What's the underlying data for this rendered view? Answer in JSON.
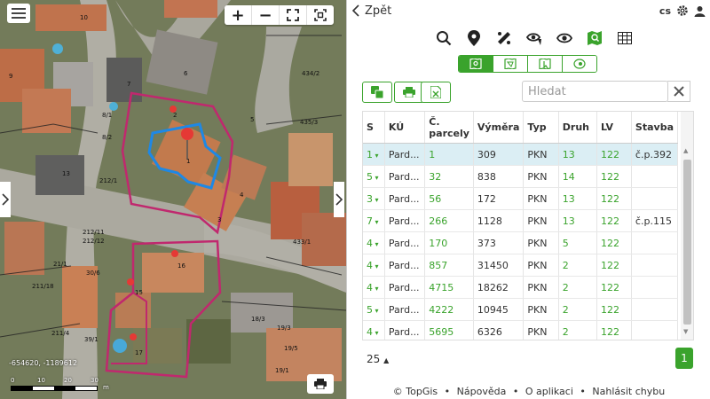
{
  "map": {
    "zoom_in": "+",
    "zoom_out": "−",
    "coords": "-654620, -1189612",
    "scale_labels": [
      "0",
      "10",
      "20",
      "30",
      "m"
    ],
    "parcel_labels": [
      "10",
      "9",
      "8",
      "7",
      "6",
      "5",
      "4",
      "3",
      "2",
      "1",
      "13",
      "14",
      "15",
      "16",
      "17",
      "18/3",
      "19/3",
      "19/5",
      "19/1",
      "8/2",
      "8/1",
      "212/1",
      "212/11",
      "212/12",
      "30/6",
      "39/1",
      "211/18",
      "211/4",
      "433/1",
      "434/2",
      "435/3",
      "26",
      "23/2",
      "21/1"
    ]
  },
  "panel": {
    "back_label": "Zpět",
    "lang": "cs",
    "search_placeholder": "Hledat",
    "page_size": "25",
    "current_page": "1",
    "footer": {
      "copyright": "© TopGis",
      "help": "Nápověda",
      "about": "O aplikaci",
      "report": "Nahlásit chybu",
      "sep": "•"
    }
  },
  "table": {
    "headers": [
      "S",
      "KÚ",
      "Č. parcely",
      "Výměra",
      "Typ",
      "Druh",
      "LV",
      "Stavba"
    ],
    "rows": [
      {
        "s": "1",
        "ku": "Pard...",
        "parcela": "1",
        "vymera": "309",
        "typ": "PKN",
        "druh": "13",
        "lv": "122",
        "stavba": "č.p.392"
      },
      {
        "s": "5",
        "ku": "Pard...",
        "parcela": "32",
        "vymera": "838",
        "typ": "PKN",
        "druh": "14",
        "lv": "122",
        "stavba": ""
      },
      {
        "s": "3",
        "ku": "Pard...",
        "parcela": "56",
        "vymera": "172",
        "typ": "PKN",
        "druh": "13",
        "lv": "122",
        "stavba": ""
      },
      {
        "s": "7",
        "ku": "Pard...",
        "parcela": "266",
        "vymera": "1128",
        "typ": "PKN",
        "druh": "13",
        "lv": "122",
        "stavba": "č.p.115"
      },
      {
        "s": "4",
        "ku": "Pard...",
        "parcela": "170",
        "vymera": "373",
        "typ": "PKN",
        "druh": "5",
        "lv": "122",
        "stavba": ""
      },
      {
        "s": "4",
        "ku": "Pard...",
        "parcela": "857",
        "vymera": "31450",
        "typ": "PKN",
        "druh": "2",
        "lv": "122",
        "stavba": ""
      },
      {
        "s": "4",
        "ku": "Pard...",
        "parcela": "4715",
        "vymera": "18262",
        "typ": "PKN",
        "druh": "2",
        "lv": "122",
        "stavba": ""
      },
      {
        "s": "5",
        "ku": "Pard...",
        "parcela": "4222",
        "vymera": "10945",
        "typ": "PKN",
        "druh": "2",
        "lv": "122",
        "stavba": ""
      },
      {
        "s": "4",
        "ku": "Pard...",
        "parcela": "5695",
        "vymera": "6326",
        "typ": "PKN",
        "druh": "2",
        "lv": "122",
        "stavba": ""
      }
    ]
  },
  "colors": {
    "accent": "#3aa32c",
    "selected_row": "#dbeef4",
    "parcel_outline": "#c0286e",
    "building_outline": "#1e88e5",
    "marker": "#e53935"
  }
}
